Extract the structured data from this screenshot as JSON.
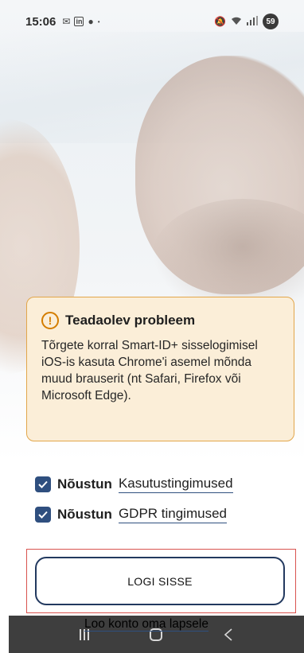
{
  "status_bar": {
    "time": "15:06",
    "battery": "59",
    "left_icons": [
      "mail-icon",
      "linkedin-icon",
      "messenger-icon",
      "dot-icon"
    ],
    "right_icons": [
      "mute-icon",
      "wifi-icon",
      "signal-icon"
    ]
  },
  "notice": {
    "title": "Teadaolev probleem",
    "body": "Tõrgete korral Smart-ID+ sisselogimisel iOS-is kasuta Chrome'i asemel mõnda muud brauserit (nt Safari, Firefox või Microsoft Edge).",
    "icon": "warning-icon"
  },
  "consents": [
    {
      "prefix": "Nõustun",
      "link": "Kasutustingimused",
      "checked": true
    },
    {
      "prefix": "Nõustun",
      "link": "GDPR tingimused",
      "checked": true
    }
  ],
  "login_button": "LOGI SISSE",
  "child_account_link": "Loo konto oma lapsele",
  "colors": {
    "accent": "#2f4f7f",
    "notice_bg": "#fbeed8",
    "notice_border": "#e2a64a",
    "warning": "#d47d00",
    "highlight": "#d9534f"
  }
}
